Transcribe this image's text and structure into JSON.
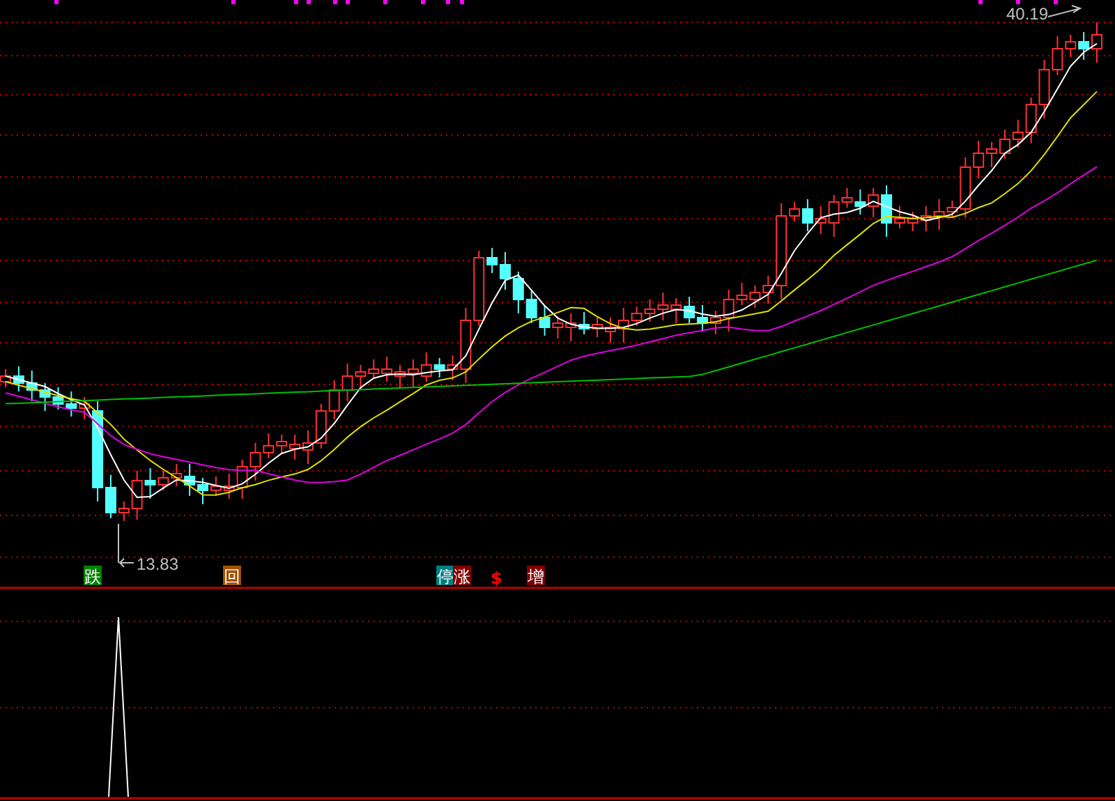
{
  "main_chart": {
    "high_label": "40.19",
    "low_label": "13.83"
  },
  "signals": [
    {
      "label": "跌",
      "kind": "badge",
      "color": "#008000"
    },
    {
      "label": "回",
      "kind": "badge",
      "color": "#a05000"
    },
    {
      "label": "停",
      "kind": "badge",
      "color": "#008080"
    },
    {
      "label": "涨",
      "kind": "badge",
      "color": "#800000"
    },
    {
      "label": "$",
      "kind": "mark",
      "color": "#ff0000"
    },
    {
      "label": "增",
      "kind": "badge",
      "color": "#800000"
    }
  ]
}
